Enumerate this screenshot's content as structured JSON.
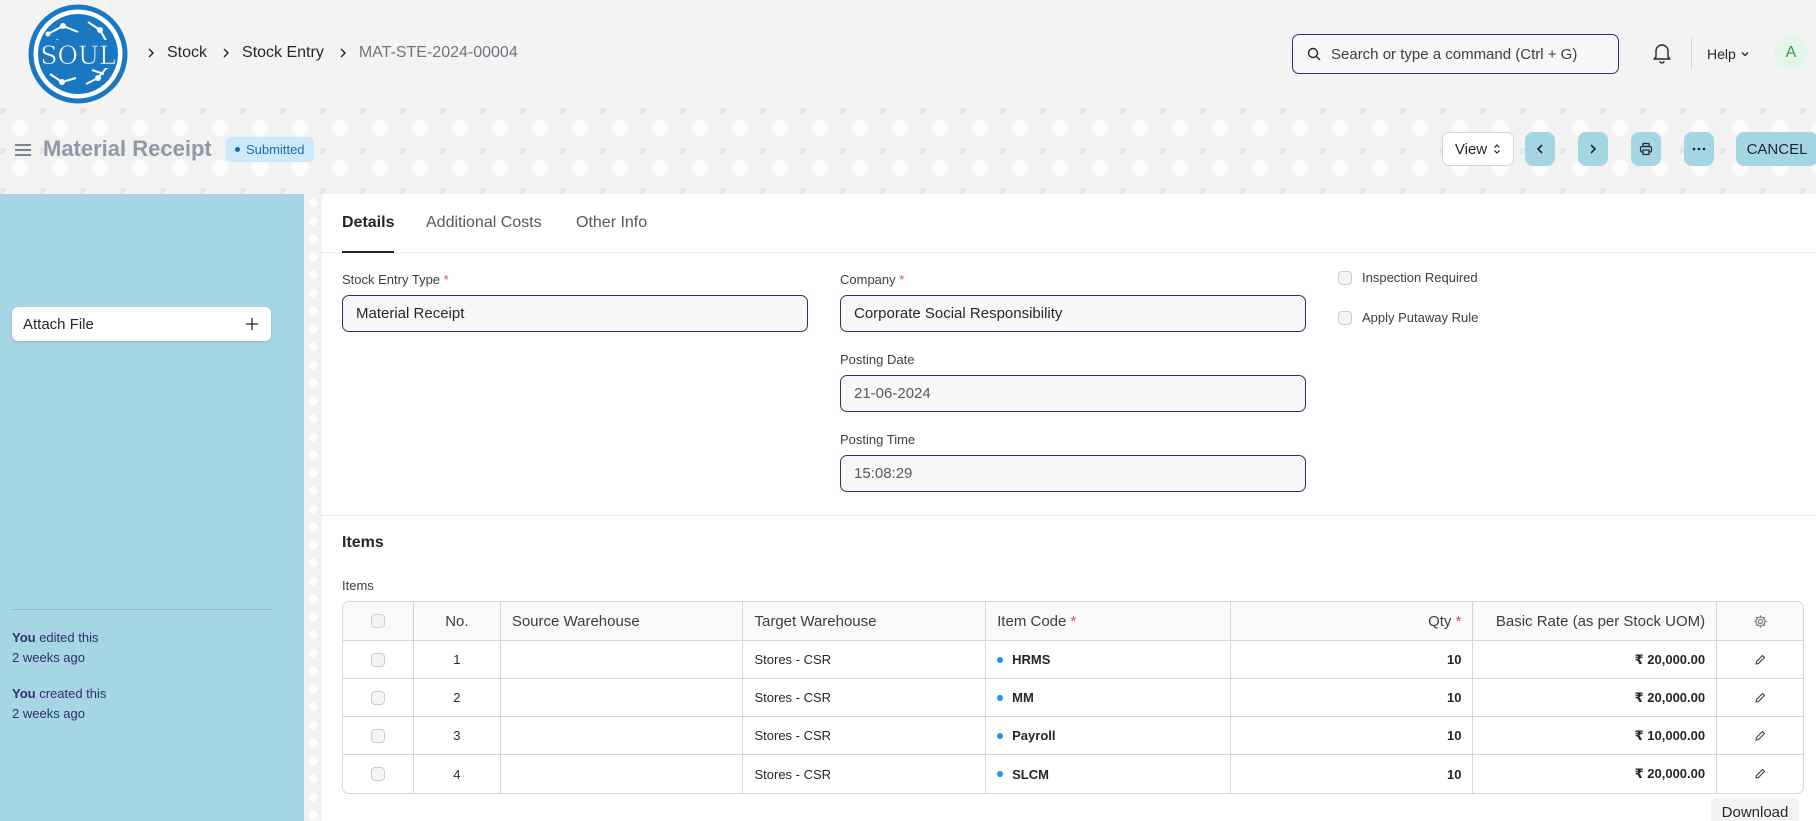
{
  "navbar": {
    "logo_text": "SOUL",
    "breadcrumbs": [
      "Stock",
      "Stock Entry",
      "MAT-STE-2024-00004"
    ],
    "search_placeholder": "Search or type a command (Ctrl + G)",
    "help_label": "Help",
    "avatar_initial": "A"
  },
  "page_head": {
    "title": "Material Receipt",
    "status": "Submitted",
    "view_label": "View",
    "cancel_label": "CANCEL"
  },
  "sidebar": {
    "attach_label": "Attach File",
    "activity": [
      {
        "actor": "You",
        "action": " edited this",
        "time": "2 weeks ago"
      },
      {
        "actor": "You",
        "action": " created this",
        "time": "2 weeks ago"
      }
    ]
  },
  "tabs": [
    "Details",
    "Additional Costs",
    "Other Info"
  ],
  "form": {
    "stock_entry_type": {
      "label": "Stock Entry Type",
      "value": "Material Receipt"
    },
    "company": {
      "label": "Company",
      "value": "Corporate Social Responsibility"
    },
    "posting_date": {
      "label": "Posting Date",
      "value": "21-06-2024"
    },
    "posting_time": {
      "label": "Posting Time",
      "value": "15:08:29"
    },
    "inspection_required": {
      "label": "Inspection Required",
      "checked": false
    },
    "apply_putaway_rule": {
      "label": "Apply Putaway Rule",
      "checked": false
    }
  },
  "items_section": {
    "title": "Items",
    "table_label": "Items",
    "columns": {
      "no": "No.",
      "source": "Source Warehouse",
      "target": "Target Warehouse",
      "item_code": "Item Code",
      "qty": "Qty",
      "rate": "Basic Rate (as per Stock UOM)"
    },
    "rows": [
      {
        "no": "1",
        "source": "",
        "target": "Stores - CSR",
        "item_code": "HRMS",
        "qty": "10",
        "rate": "₹ 20,000.00"
      },
      {
        "no": "2",
        "source": "",
        "target": "Stores - CSR",
        "item_code": "MM",
        "qty": "10",
        "rate": "₹ 20,000.00"
      },
      {
        "no": "3",
        "source": "",
        "target": "Stores - CSR",
        "item_code": "Payroll",
        "qty": "10",
        "rate": "₹ 10,000.00"
      },
      {
        "no": "4",
        "source": "",
        "target": "Stores - CSR",
        "item_code": "SLCM",
        "qty": "10",
        "rate": "₹ 20,000.00"
      }
    ],
    "download_label": "Download"
  },
  "colors": {
    "sidebar_bg": "#a6d5e3",
    "accent_button": "#a3d5e3",
    "input_border": "#2e2f6e",
    "status_bg": "#cde9fb",
    "status_text": "#1b69a8",
    "logo_blue": "#1a78c2"
  }
}
